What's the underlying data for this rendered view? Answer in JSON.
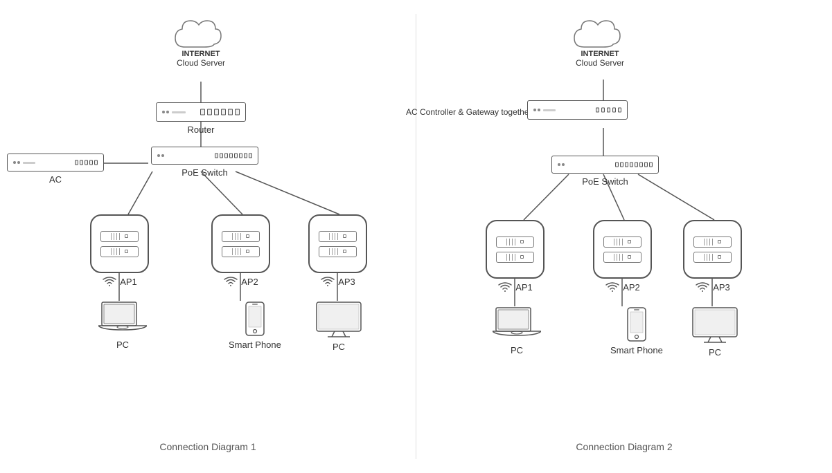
{
  "diagram1": {
    "title": "Connection Diagram 1",
    "cloud": {
      "line1": "INTERNET",
      "line2": "Cloud Server"
    },
    "router_label": "Router",
    "poe_switch_label": "PoE Switch",
    "ac_label": "AC",
    "ap_labels": [
      "AP1",
      "AP2",
      "AP3"
    ],
    "device_labels": [
      "PC",
      "Smart Phone",
      "PC"
    ]
  },
  "diagram2": {
    "title": "Connection Diagram 2",
    "cloud": {
      "line1": "INTERNET",
      "line2": "Cloud Server"
    },
    "ac_label": "AC Controller & Gateway together",
    "poe_switch_label": "PoE Switch",
    "ap_labels": [
      "AP1",
      "AP2",
      "AP3"
    ],
    "device_labels": [
      "PC",
      "Smart Phone",
      "PC"
    ]
  }
}
